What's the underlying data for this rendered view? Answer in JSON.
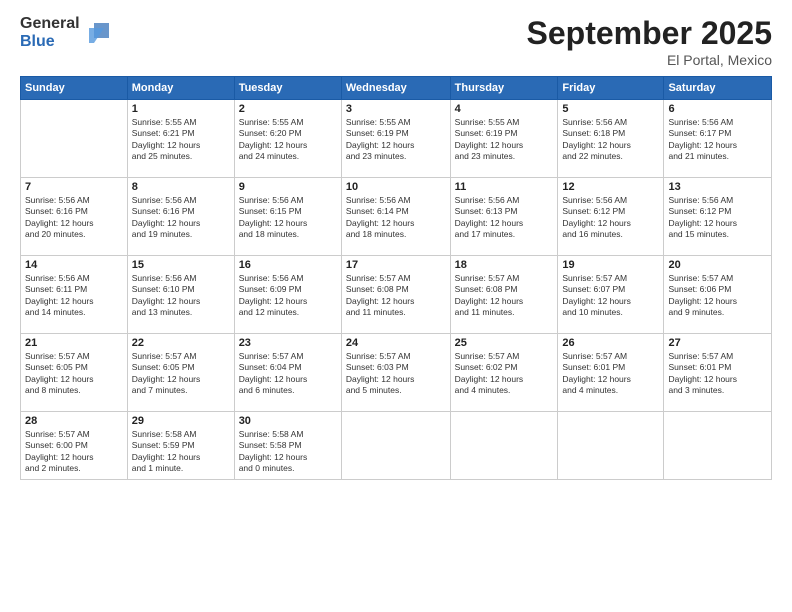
{
  "logo": {
    "general": "General",
    "blue": "Blue"
  },
  "title": "September 2025",
  "location": "El Portal, Mexico",
  "days_header": [
    "Sunday",
    "Monday",
    "Tuesday",
    "Wednesday",
    "Thursday",
    "Friday",
    "Saturday"
  ],
  "weeks": [
    [
      {
        "day": "",
        "info": ""
      },
      {
        "day": "1",
        "info": "Sunrise: 5:55 AM\nSunset: 6:21 PM\nDaylight: 12 hours\nand 25 minutes."
      },
      {
        "day": "2",
        "info": "Sunrise: 5:55 AM\nSunset: 6:20 PM\nDaylight: 12 hours\nand 24 minutes."
      },
      {
        "day": "3",
        "info": "Sunrise: 5:55 AM\nSunset: 6:19 PM\nDaylight: 12 hours\nand 23 minutes."
      },
      {
        "day": "4",
        "info": "Sunrise: 5:55 AM\nSunset: 6:19 PM\nDaylight: 12 hours\nand 23 minutes."
      },
      {
        "day": "5",
        "info": "Sunrise: 5:56 AM\nSunset: 6:18 PM\nDaylight: 12 hours\nand 22 minutes."
      },
      {
        "day": "6",
        "info": "Sunrise: 5:56 AM\nSunset: 6:17 PM\nDaylight: 12 hours\nand 21 minutes."
      }
    ],
    [
      {
        "day": "7",
        "info": "Sunrise: 5:56 AM\nSunset: 6:16 PM\nDaylight: 12 hours\nand 20 minutes."
      },
      {
        "day": "8",
        "info": "Sunrise: 5:56 AM\nSunset: 6:16 PM\nDaylight: 12 hours\nand 19 minutes."
      },
      {
        "day": "9",
        "info": "Sunrise: 5:56 AM\nSunset: 6:15 PM\nDaylight: 12 hours\nand 18 minutes."
      },
      {
        "day": "10",
        "info": "Sunrise: 5:56 AM\nSunset: 6:14 PM\nDaylight: 12 hours\nand 18 minutes."
      },
      {
        "day": "11",
        "info": "Sunrise: 5:56 AM\nSunset: 6:13 PM\nDaylight: 12 hours\nand 17 minutes."
      },
      {
        "day": "12",
        "info": "Sunrise: 5:56 AM\nSunset: 6:12 PM\nDaylight: 12 hours\nand 16 minutes."
      },
      {
        "day": "13",
        "info": "Sunrise: 5:56 AM\nSunset: 6:12 PM\nDaylight: 12 hours\nand 15 minutes."
      }
    ],
    [
      {
        "day": "14",
        "info": "Sunrise: 5:56 AM\nSunset: 6:11 PM\nDaylight: 12 hours\nand 14 minutes."
      },
      {
        "day": "15",
        "info": "Sunrise: 5:56 AM\nSunset: 6:10 PM\nDaylight: 12 hours\nand 13 minutes."
      },
      {
        "day": "16",
        "info": "Sunrise: 5:56 AM\nSunset: 6:09 PM\nDaylight: 12 hours\nand 12 minutes."
      },
      {
        "day": "17",
        "info": "Sunrise: 5:57 AM\nSunset: 6:08 PM\nDaylight: 12 hours\nand 11 minutes."
      },
      {
        "day": "18",
        "info": "Sunrise: 5:57 AM\nSunset: 6:08 PM\nDaylight: 12 hours\nand 11 minutes."
      },
      {
        "day": "19",
        "info": "Sunrise: 5:57 AM\nSunset: 6:07 PM\nDaylight: 12 hours\nand 10 minutes."
      },
      {
        "day": "20",
        "info": "Sunrise: 5:57 AM\nSunset: 6:06 PM\nDaylight: 12 hours\nand 9 minutes."
      }
    ],
    [
      {
        "day": "21",
        "info": "Sunrise: 5:57 AM\nSunset: 6:05 PM\nDaylight: 12 hours\nand 8 minutes."
      },
      {
        "day": "22",
        "info": "Sunrise: 5:57 AM\nSunset: 6:05 PM\nDaylight: 12 hours\nand 7 minutes."
      },
      {
        "day": "23",
        "info": "Sunrise: 5:57 AM\nSunset: 6:04 PM\nDaylight: 12 hours\nand 6 minutes."
      },
      {
        "day": "24",
        "info": "Sunrise: 5:57 AM\nSunset: 6:03 PM\nDaylight: 12 hours\nand 5 minutes."
      },
      {
        "day": "25",
        "info": "Sunrise: 5:57 AM\nSunset: 6:02 PM\nDaylight: 12 hours\nand 4 minutes."
      },
      {
        "day": "26",
        "info": "Sunrise: 5:57 AM\nSunset: 6:01 PM\nDaylight: 12 hours\nand 4 minutes."
      },
      {
        "day": "27",
        "info": "Sunrise: 5:57 AM\nSunset: 6:01 PM\nDaylight: 12 hours\nand 3 minutes."
      }
    ],
    [
      {
        "day": "28",
        "info": "Sunrise: 5:57 AM\nSunset: 6:00 PM\nDaylight: 12 hours\nand 2 minutes."
      },
      {
        "day": "29",
        "info": "Sunrise: 5:58 AM\nSunset: 5:59 PM\nDaylight: 12 hours\nand 1 minute."
      },
      {
        "day": "30",
        "info": "Sunrise: 5:58 AM\nSunset: 5:58 PM\nDaylight: 12 hours\nand 0 minutes."
      },
      {
        "day": "",
        "info": ""
      },
      {
        "day": "",
        "info": ""
      },
      {
        "day": "",
        "info": ""
      },
      {
        "day": "",
        "info": ""
      }
    ]
  ]
}
